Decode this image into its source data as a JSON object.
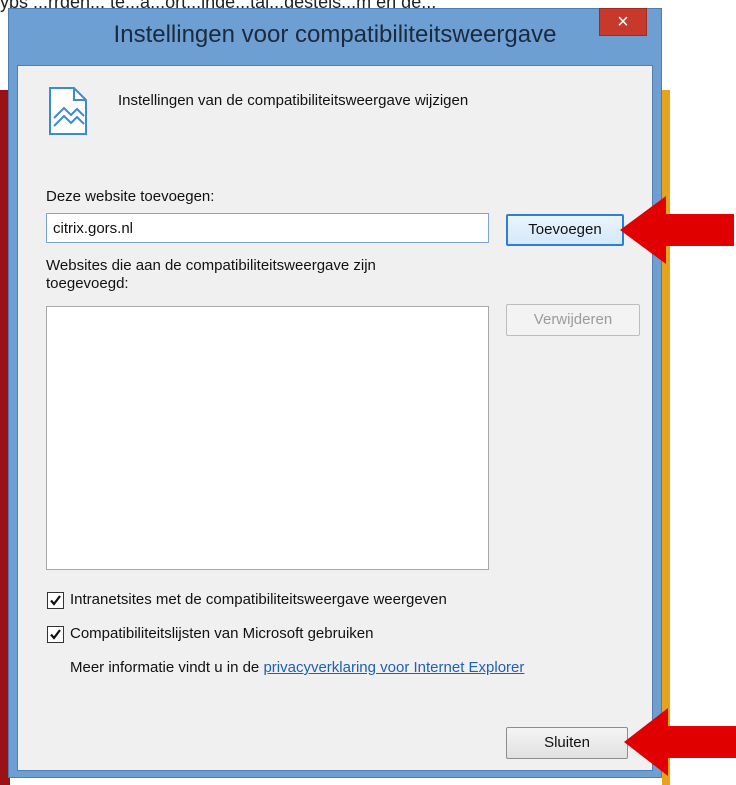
{
  "background": {
    "top_text_fragment": "yps ...rrgen... te...a...ort...inde...tal...gestels...m en ge..."
  },
  "dialog": {
    "title": "Instellingen voor compatibiliteitsweergave",
    "close_glyph": "×",
    "header_text": "Instellingen van de compatibiliteitsweergave wijzigen",
    "add_label": "Deze website toevoegen:",
    "site_input_value": "citrix.gors.nl",
    "add_button": "Toevoegen",
    "list_label_line1": "Websites die aan de compatibiliteitsweergave zijn",
    "list_label_line2": "toegevoegd:",
    "remove_button": "Verwijderen",
    "checkbox1": {
      "label": "Intranetsites met de compatibiliteitsweergave weergeven",
      "checked": true
    },
    "checkbox2": {
      "label": "Compatibiliteitslijsten van Microsoft gebruiken",
      "checked": true
    },
    "info_prefix": "Meer informatie vindt u in de",
    "info_link": "privacyverklaring voor Internet Explorer",
    "close_button": "Sluiten"
  },
  "icons": {
    "header": "compatibility-view-icon",
    "close": "close-icon",
    "check": "checkmark-icon",
    "annotation": "red-arrow-icon"
  },
  "colors": {
    "window_frame": "#6e9fd3",
    "close_button": "#c7392b",
    "link": "#1e5fb8",
    "annotation_arrow": "#e00000"
  }
}
